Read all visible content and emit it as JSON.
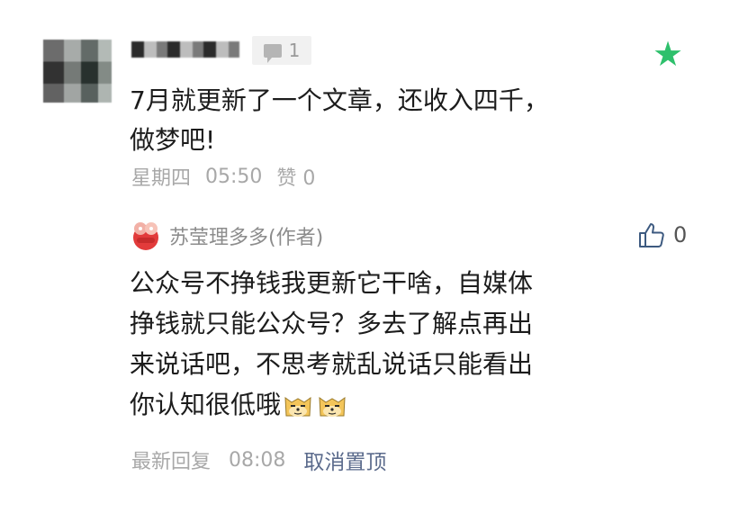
{
  "comment": {
    "badge_count": "1",
    "text_lines": [
      "7月就更新了一个文章，还收入四千，",
      "做梦吧!"
    ],
    "day": "星期四",
    "time": "05:50",
    "likes": "赞 0"
  },
  "reply": {
    "author": "苏莹理多多(作者)",
    "like_count": "0",
    "text_lines": [
      "公众号不挣钱我更新它干啥，自媒体",
      "挣钱就只能公众号？多去了解点再出",
      "来说话吧，不思考就乱说话只能看出",
      "你认知很低哦"
    ],
    "meta_label": "最新回复",
    "meta_time": "08:08",
    "unpin_label": "取消置顶"
  },
  "colors": {
    "star": "#2ec06c",
    "link": "#5b6b8c",
    "muted": "#a8a8a8"
  },
  "icons": {
    "badge": "message-icon",
    "star": "star-icon",
    "like": "thumbs-up-icon",
    "emoji": "doge-emoji-icon"
  }
}
